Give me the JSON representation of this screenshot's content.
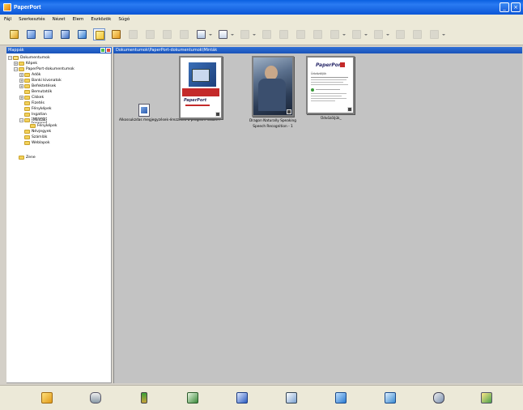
{
  "window": {
    "title": "PaperPort"
  },
  "menu": [
    "Fájl",
    "Szerkesztés",
    "Nézet",
    "Elem",
    "Eszközök",
    "Súgó"
  ],
  "left_pane": {
    "title": "Mappák"
  },
  "tree": [
    {
      "label": "Dokumentumok",
      "exp": "-",
      "depth": 0,
      "root": true
    },
    {
      "label": "Képek",
      "exp": "+",
      "depth": 1
    },
    {
      "label": "PaperPort-dokumentumok",
      "exp": "-",
      "depth": 1
    },
    {
      "label": "Adók",
      "exp": "+",
      "depth": 2
    },
    {
      "label": "Banki kivonatok",
      "exp": "+",
      "depth": 2
    },
    {
      "label": "Befektetések",
      "exp": "+",
      "depth": 2
    },
    {
      "label": "Bemutatók",
      "exp": "",
      "depth": 2
    },
    {
      "label": "Cikkek",
      "exp": "+",
      "depth": 2
    },
    {
      "label": "Fizetés",
      "exp": "",
      "depth": 2
    },
    {
      "label": "Fényképek",
      "exp": "",
      "depth": 2
    },
    {
      "label": "Ingatlan",
      "exp": "",
      "depth": 2
    },
    {
      "label": "Minták",
      "exp": "-",
      "depth": 2,
      "selected": true
    },
    {
      "label": "Fényképek",
      "exp": "",
      "depth": 3
    },
    {
      "label": "Névjegyek",
      "exp": "",
      "depth": 2
    },
    {
      "label": "Számlák",
      "exp": "",
      "depth": 2
    },
    {
      "label": "Weblapok",
      "exp": "",
      "depth": 2
    },
    {
      "label": "Zene",
      "exp": "",
      "depth": 0
    }
  ],
  "path": "Dokumentumok\\PaperPort-dokumentumok\\Minták",
  "items": [
    {
      "label": "Alkossukzdas megjegyzések-érezzétek a program haszn..."
    },
    {
      "label": "PaperPort",
      "badge": "PaperPort"
    },
    {
      "label_line1": "Dragon Naturally Speaking",
      "label_line2": "Speech Recognition - 1"
    },
    {
      "label": "Üdvözöljük_",
      "logo": "PaperPort",
      "doc_heading": "Üdvözöljük"
    }
  ],
  "colors": {
    "title_bar": "#0b55d6",
    "pane_header": "#1a53b8",
    "workspace": "#c3c3c3",
    "chrome": "#ece9d8"
  },
  "toolbar_icons": [
    "scan-icon",
    "send-icon",
    "copy-icon",
    "view-icon",
    "new-folder-icon",
    "stack-icon",
    "unstack-icon",
    "rotate-icon",
    "annotate-icon",
    "thumbnail-icon",
    "page-view-icon",
    "sort-icon",
    "search-icon",
    "delete-icon",
    "properties-icon",
    "back-icon",
    "forward-icon",
    "zoom-icon",
    "help-icon"
  ],
  "bottom_icons": [
    "paperport-icon",
    "scanner-icon",
    "pen-icon",
    "spreadsheet-icon",
    "word-icon",
    "notepad-icon",
    "paint-icon",
    "ftp-icon",
    "network-icon",
    "photo-icon"
  ]
}
